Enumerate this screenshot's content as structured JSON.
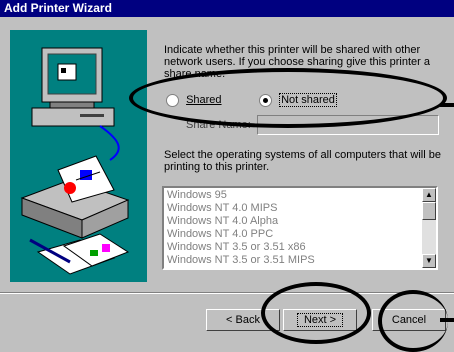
{
  "window": {
    "title": "Add Printer Wizard"
  },
  "intro_text_lines": [
    "Indicate whether this printer will be shared with other",
    "network users.  If you choose sharing give this printer a",
    "share name."
  ],
  "sharing": {
    "shared_label": "Shared",
    "not_shared_label": "Not shared",
    "selected": "Not shared",
    "share_name_label": "Share Name:",
    "share_name_value": ""
  },
  "os_prompt_lines": [
    "Select the operating systems of all computers that will be",
    "printing to this printer."
  ],
  "os_list": [
    "Windows 95",
    "Windows NT 4.0 MIPS",
    "Windows NT 4.0 Alpha",
    "Windows NT 4.0 PPC",
    "Windows NT 3.5 or 3.51 x86",
    "Windows NT 3.5 or 3.51 MIPS"
  ],
  "buttons": {
    "back": "< Back",
    "next": "Next >",
    "cancel": "Cancel"
  }
}
